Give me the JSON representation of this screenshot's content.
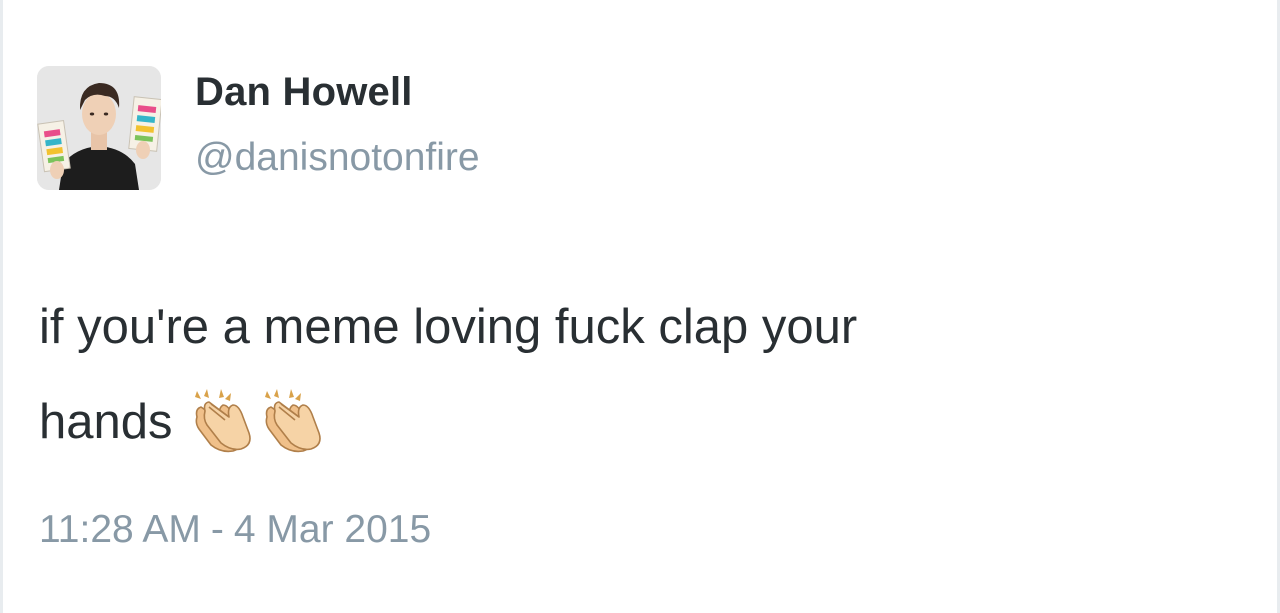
{
  "tweet": {
    "author": {
      "display_name": "Dan Howell",
      "handle": "@danisnotonfire",
      "avatar_icon": "profile-photo-avatar"
    },
    "text": {
      "line1": "if you're a meme loving fuck clap your",
      "line2": "hands",
      "emojis": [
        "clapping-hands-emoji",
        "clapping-hands-emoji"
      ]
    },
    "timestamp": {
      "time": "11:28 AM",
      "separator": "-",
      "date": "4 Mar 2015"
    }
  },
  "colors": {
    "name": "#292f33",
    "secondary": "#8899a6",
    "border": "#e8ecef",
    "emoji_skin": "#f4c591"
  }
}
